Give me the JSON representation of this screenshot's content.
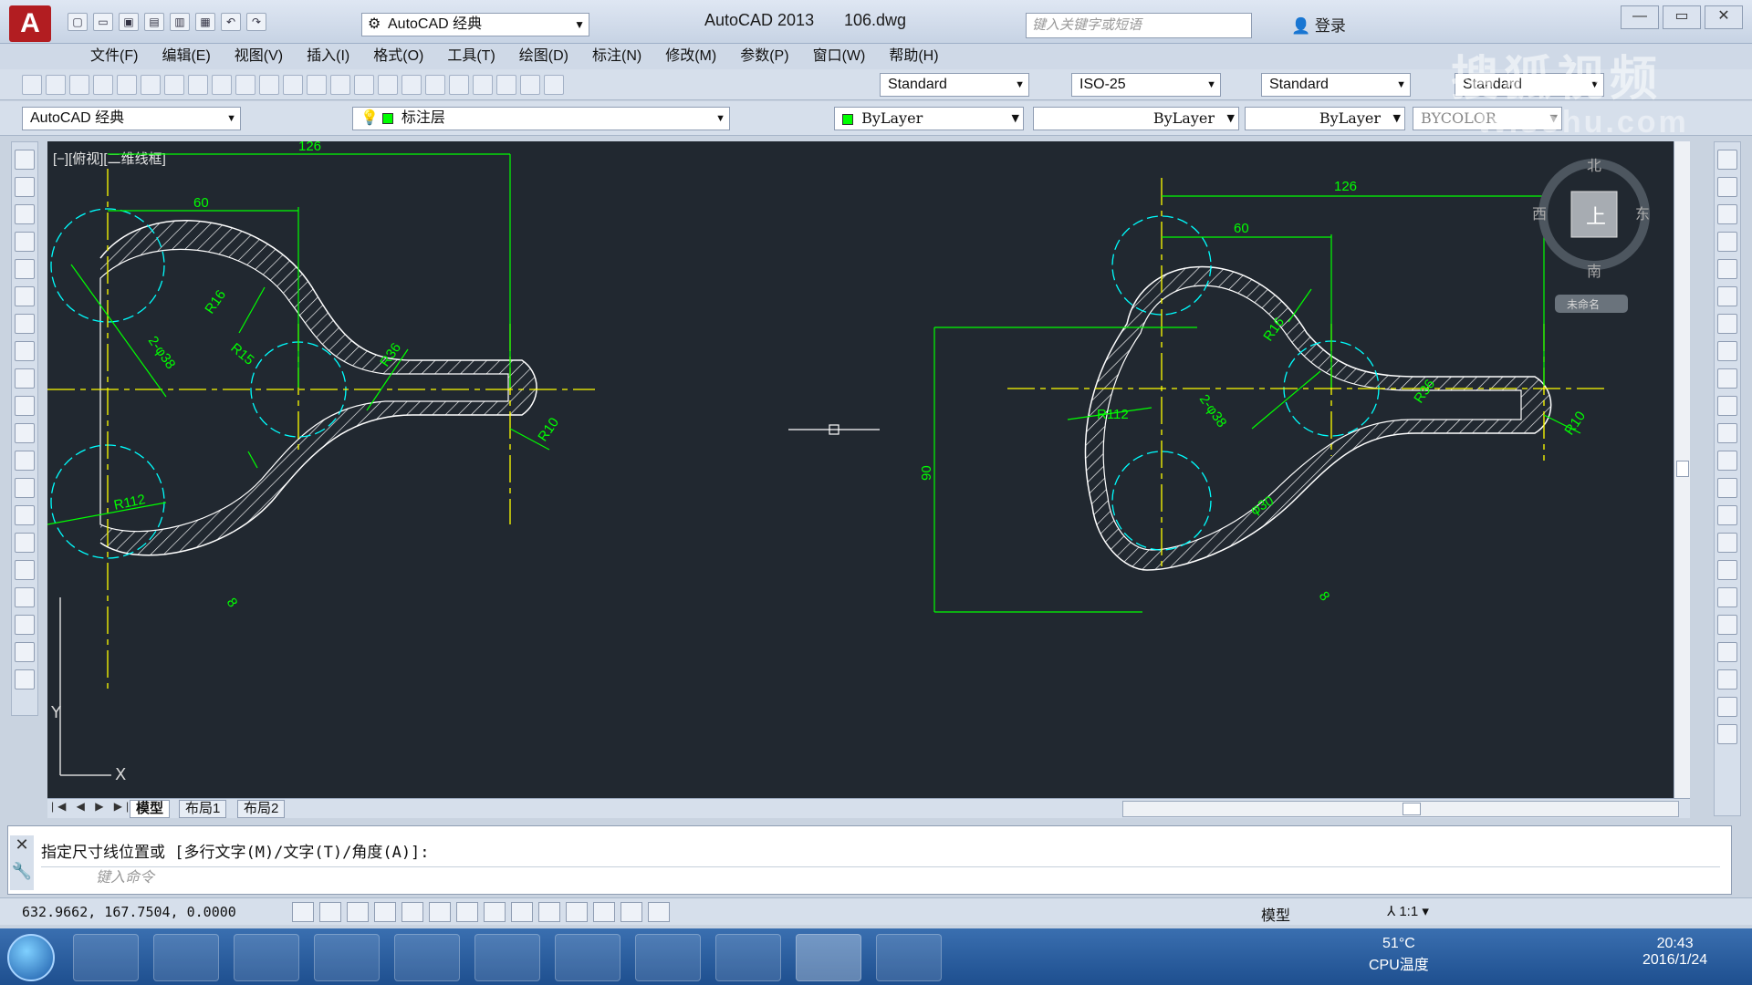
{
  "window": {
    "app_title": "AutoCAD 2013",
    "file_name": "106.dwg",
    "workspace": "AutoCAD 经典",
    "search_placeholder": "键入关键字或短语",
    "login_label": "登录"
  },
  "menu": [
    "文件(F)",
    "编辑(E)",
    "视图(V)",
    "插入(I)",
    "格式(O)",
    "工具(T)",
    "绘图(D)",
    "标注(N)",
    "修改(M)",
    "参数(P)",
    "窗口(W)",
    "帮助(H)"
  ],
  "styles_toolbar": {
    "text_style": "Standard",
    "dim_style": "ISO-25",
    "table_style": "Standard",
    "multileader_style": "Standard"
  },
  "layers_toolbar": {
    "workspace": "AutoCAD 经典",
    "layer": "标注层",
    "color": "ByLayer",
    "linetype": "ByLayer",
    "lineweight": "ByLayer",
    "plotstyle": "BYCOLOR"
  },
  "viewport": {
    "label": "[−][俯视][二维线框]"
  },
  "viewcube": {
    "north": "北",
    "south": "南",
    "east": "东",
    "west": "西",
    "top": "上",
    "ucs": "未命名"
  },
  "drawing_left": {
    "dims": [
      "126",
      "60",
      "R16",
      "R36",
      "R15",
      "R10",
      "2-φ38",
      "R112",
      "8"
    ]
  },
  "drawing_right": {
    "dims": [
      "126",
      "60",
      "90",
      "R16",
      "R36",
      "R112",
      "2-φ38",
      "R10",
      "φ30",
      "8"
    ]
  },
  "tabs": [
    "模型",
    "布局1",
    "布局2"
  ],
  "command": {
    "history": "指定尺寸线位置或 [多行文字(M)/文字(T)/角度(A)]:",
    "placeholder": "键入命令"
  },
  "status": {
    "coords": "632.9662,  167.7504,  0.0000",
    "model": "模型",
    "scale": "1:1"
  },
  "taskbar": {
    "temp": "51°C",
    "temp_label": "CPU温度",
    "time": "20:43",
    "date": "2016/1/24"
  },
  "watermark": {
    "line1": "搜狐视频",
    "line2": "tv.sohu.com"
  },
  "colors": {
    "canvas_bg": "#212830",
    "dim_green": "#00ff00",
    "center_yellow": "#ffff00",
    "circle_cyan": "#00ffff",
    "hatch_white": "#ffffff"
  }
}
